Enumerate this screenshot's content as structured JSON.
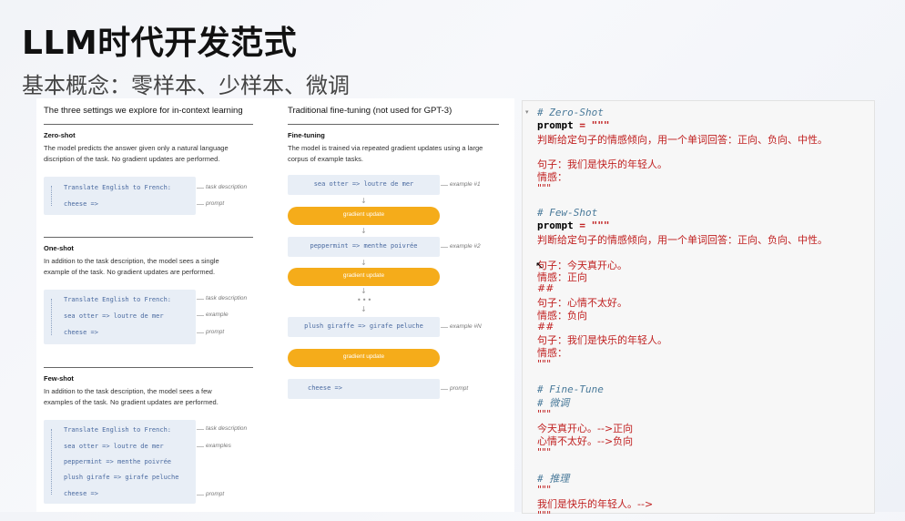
{
  "slide": {
    "title": "LLM时代开发范式",
    "subtitle": "基本概念：零样本、少样本、微调"
  },
  "figure": {
    "left_header": "The three settings we explore for in-context learning",
    "right_header": "Traditional fine-tuning (not used for GPT-3)",
    "zero_shot": {
      "heading": "Zero-shot",
      "desc": "The model predicts the answer given only a natural language discription of the task. No gradient updates are performed.",
      "lines": [
        "Translate English to French:",
        "cheese =>"
      ],
      "annots": [
        "task description",
        "prompt"
      ]
    },
    "one_shot": {
      "heading": "One-shot",
      "desc": "In addition to the task description, the model sees a single example of the task. No gradient updates are performed.",
      "lines": [
        "Translate English to French:",
        "sea otter => loutre de mer",
        "cheese =>"
      ],
      "annots": [
        "task description",
        "example",
        "prompt"
      ]
    },
    "few_shot": {
      "heading": "Few-shot",
      "desc": "In addition to the task description, the model sees a few examples of the task. No gradient updates are performed.",
      "lines": [
        "Translate English to French:",
        "sea otter => loutre de mer",
        "peppermint => menthe poivrée",
        "plush girafe => girafe peluche",
        "cheese =>"
      ],
      "annots": [
        "task description",
        "examples",
        "prompt"
      ]
    },
    "fine_tuning": {
      "heading": "Fine-tuning",
      "desc": "The model is trained via repeated gradient updates using a large corpus of example tasks.",
      "ex1": "sea otter => loutre de mer",
      "ex1_annot": "example #1",
      "ex2": "peppermint => menthe poivrée",
      "ex2_annot": "example #2",
      "exN": "plush giraffe => girafe peluche",
      "exN_annot": "example #N",
      "gradient_label": "gradient update",
      "prompt": "cheese =>",
      "prompt_annot": "prompt"
    }
  },
  "code": {
    "lines": [
      {
        "cls": "cm",
        "text": "# Zero-Shot"
      },
      {
        "cls": "kw",
        "text": "prompt = \"\"\""
      },
      {
        "cls": "cn",
        "text": "判断给定句子的情感倾向，用一个单词回答：正向、负向、中性。"
      },
      {
        "cls": "",
        "text": ""
      },
      {
        "cls": "cn",
        "text": "句子：我们是快乐的年轻人。"
      },
      {
        "cls": "cn",
        "text": "情感："
      },
      {
        "cls": "cn",
        "text": "\"\"\""
      },
      {
        "cls": "",
        "text": ""
      },
      {
        "cls": "cm",
        "text": "# Few-Shot"
      },
      {
        "cls": "kw",
        "text": "prompt = \"\"\""
      },
      {
        "cls": "cn",
        "text": "判断给定句子的情感倾向，用一个单词回答：正向、负向、中性。"
      },
      {
        "cls": "",
        "text": ""
      },
      {
        "cls": "cn",
        "text": "句子：今天真开心。"
      },
      {
        "cls": "cn",
        "text": "情感：正向"
      },
      {
        "cls": "cn",
        "text": "##"
      },
      {
        "cls": "cn",
        "text": "句子：心情不太好。"
      },
      {
        "cls": "cn",
        "text": "情感：负向"
      },
      {
        "cls": "cn",
        "text": "##"
      },
      {
        "cls": "cn",
        "text": "句子：我们是快乐的年轻人。"
      },
      {
        "cls": "cn",
        "text": "情感："
      },
      {
        "cls": "cn",
        "text": "\"\"\""
      },
      {
        "cls": "",
        "text": ""
      },
      {
        "cls": "cm",
        "text": "# Fine-Tune"
      },
      {
        "cls": "cm",
        "text": "# 微调"
      },
      {
        "cls": "cn",
        "text": "\"\"\""
      },
      {
        "cls": "cn",
        "text": "今天真开心。-->正向"
      },
      {
        "cls": "cn",
        "text": "心情不太好。-->负向"
      },
      {
        "cls": "cn",
        "text": "\"\"\""
      },
      {
        "cls": "",
        "text": ""
      },
      {
        "cls": "cm",
        "text": "# 推理"
      },
      {
        "cls": "cn",
        "text": "\"\"\""
      },
      {
        "cls": "cn",
        "text": "我们是快乐的年轻人。-->"
      },
      {
        "cls": "cn",
        "text": "\"\"\""
      }
    ]
  },
  "icons": {
    "fold": "chevron-down-icon",
    "down_arrow": "arrow-down-icon"
  },
  "colors": {
    "gradient_pill": "#f5ac1a",
    "code_comment": "#4a7a9a",
    "code_string": "#c02020",
    "example_box": "#e8eef6"
  }
}
